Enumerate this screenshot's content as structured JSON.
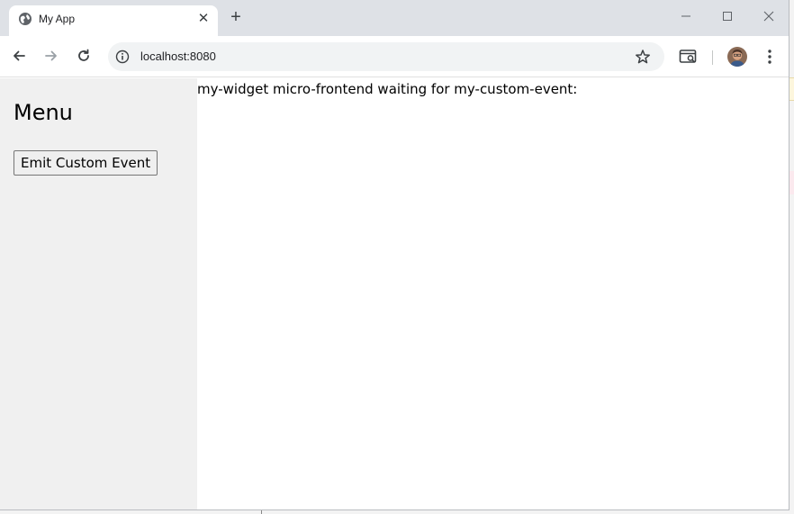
{
  "browser": {
    "tab": {
      "title": "My App",
      "favicon": "globe-icon",
      "close": "✕"
    },
    "new_tab": "+",
    "window_controls": {
      "minimize": "—",
      "maximize": "☐",
      "close": "✕"
    },
    "address": {
      "url": "localhost:8080"
    }
  },
  "page": {
    "sidebar": {
      "heading": "Menu",
      "button_label": "Emit Custom Event"
    },
    "main": {
      "message": "my-widget micro-frontend waiting for my-custom-event:"
    }
  },
  "colors": {
    "tabstrip": "#dee1e6",
    "omnibox": "#f1f3f4",
    "sidebar_bg": "#f0f0f0",
    "button_bg": "#efefef"
  }
}
